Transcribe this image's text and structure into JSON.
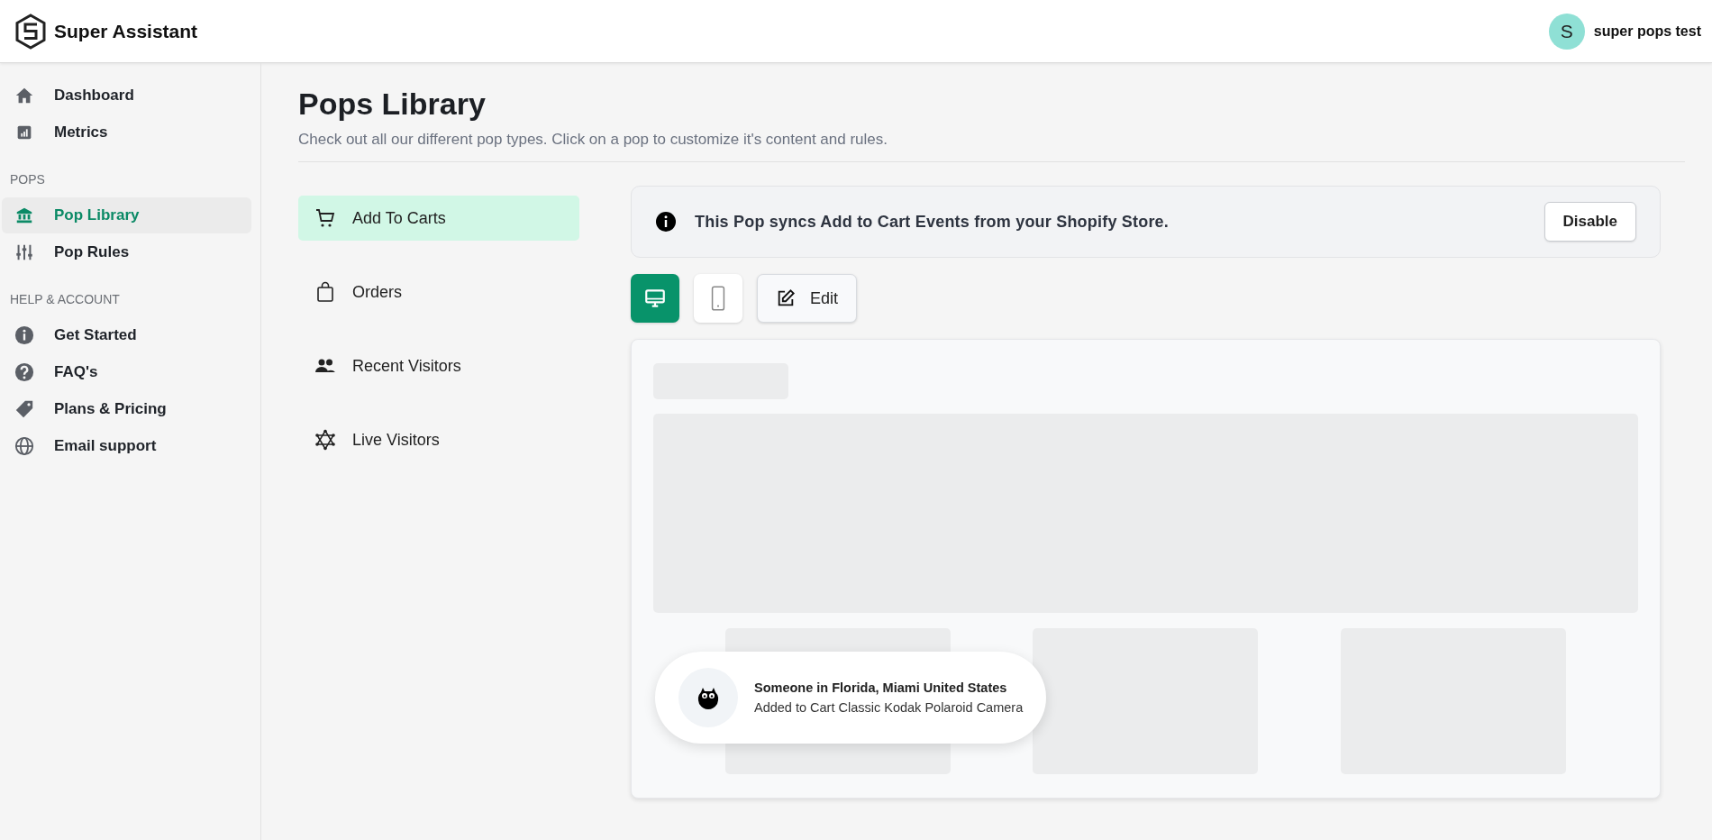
{
  "header": {
    "brand": "Super Assistant",
    "user": {
      "initial": "S",
      "name": "super pops test"
    }
  },
  "sidebar": {
    "sections": [
      {
        "items": [
          {
            "label": "Dashboard",
            "selected": false
          },
          {
            "label": "Metrics",
            "selected": false
          }
        ]
      },
      {
        "heading": "POPS",
        "items": [
          {
            "label": "Pop Library",
            "selected": true
          },
          {
            "label": "Pop Rules",
            "selected": false
          }
        ]
      },
      {
        "heading": "HELP & ACCOUNT",
        "items": [
          {
            "label": "Get Started",
            "selected": false
          },
          {
            "label": "FAQ's",
            "selected": false
          },
          {
            "label": "Plans & Pricing",
            "selected": false
          },
          {
            "label": "Email support",
            "selected": false
          }
        ]
      }
    ]
  },
  "page": {
    "title": "Pops Library",
    "subtitle": "Check out all our different pop types. Click on a pop to customize it's content and rules."
  },
  "pop_types": [
    {
      "label": "Add To Carts",
      "selected": true
    },
    {
      "label": "Orders",
      "selected": false
    },
    {
      "label": "Recent Visitors",
      "selected": false
    },
    {
      "label": "Live Visitors",
      "selected": false
    }
  ],
  "banner": {
    "text": "This Pop syncs Add to Cart Events from your Shopify Store.",
    "button": "Disable"
  },
  "view_toggle": [
    {
      "selected": true
    },
    {
      "selected": false
    }
  ],
  "edit_button": "Edit",
  "toast": {
    "title": "Someone in Florida, Miami United States",
    "message": "Added to Cart Classic Kodak Polaroid Camera"
  }
}
